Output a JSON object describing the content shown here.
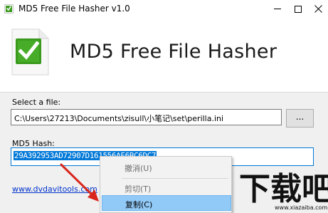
{
  "window": {
    "title": "MD5 Free File Hasher v1.0"
  },
  "banner": {
    "heading": "MD5 Free File Hasher"
  },
  "file": {
    "label": "Select a file:",
    "path": "C:\\Users\\27213\\Documents\\zisull\\小笔记\\set\\perilla.ini",
    "browse_label": "..."
  },
  "hash": {
    "label": "MD5 Hash:",
    "value": "29A392953AD72907D161556AE6BC6DC7"
  },
  "footer": {
    "link": "www.dvdavitools.com"
  },
  "context_menu": {
    "undo": "撤消(U)",
    "cut": "剪切(T)",
    "copy": "复制(C)"
  },
  "watermark": {
    "logo_text": "下载吧",
    "url": "www.xiazaiba.com"
  },
  "colors": {
    "accent": "#0078d7",
    "selection_highlight": "#91c9f7",
    "check_green": "#3a9a1e",
    "arrow_red": "#d9261c"
  },
  "icons": {
    "app": "check-document-icon",
    "minimize": "minimize-icon",
    "maximize": "maximize-icon",
    "close": "close-icon"
  }
}
